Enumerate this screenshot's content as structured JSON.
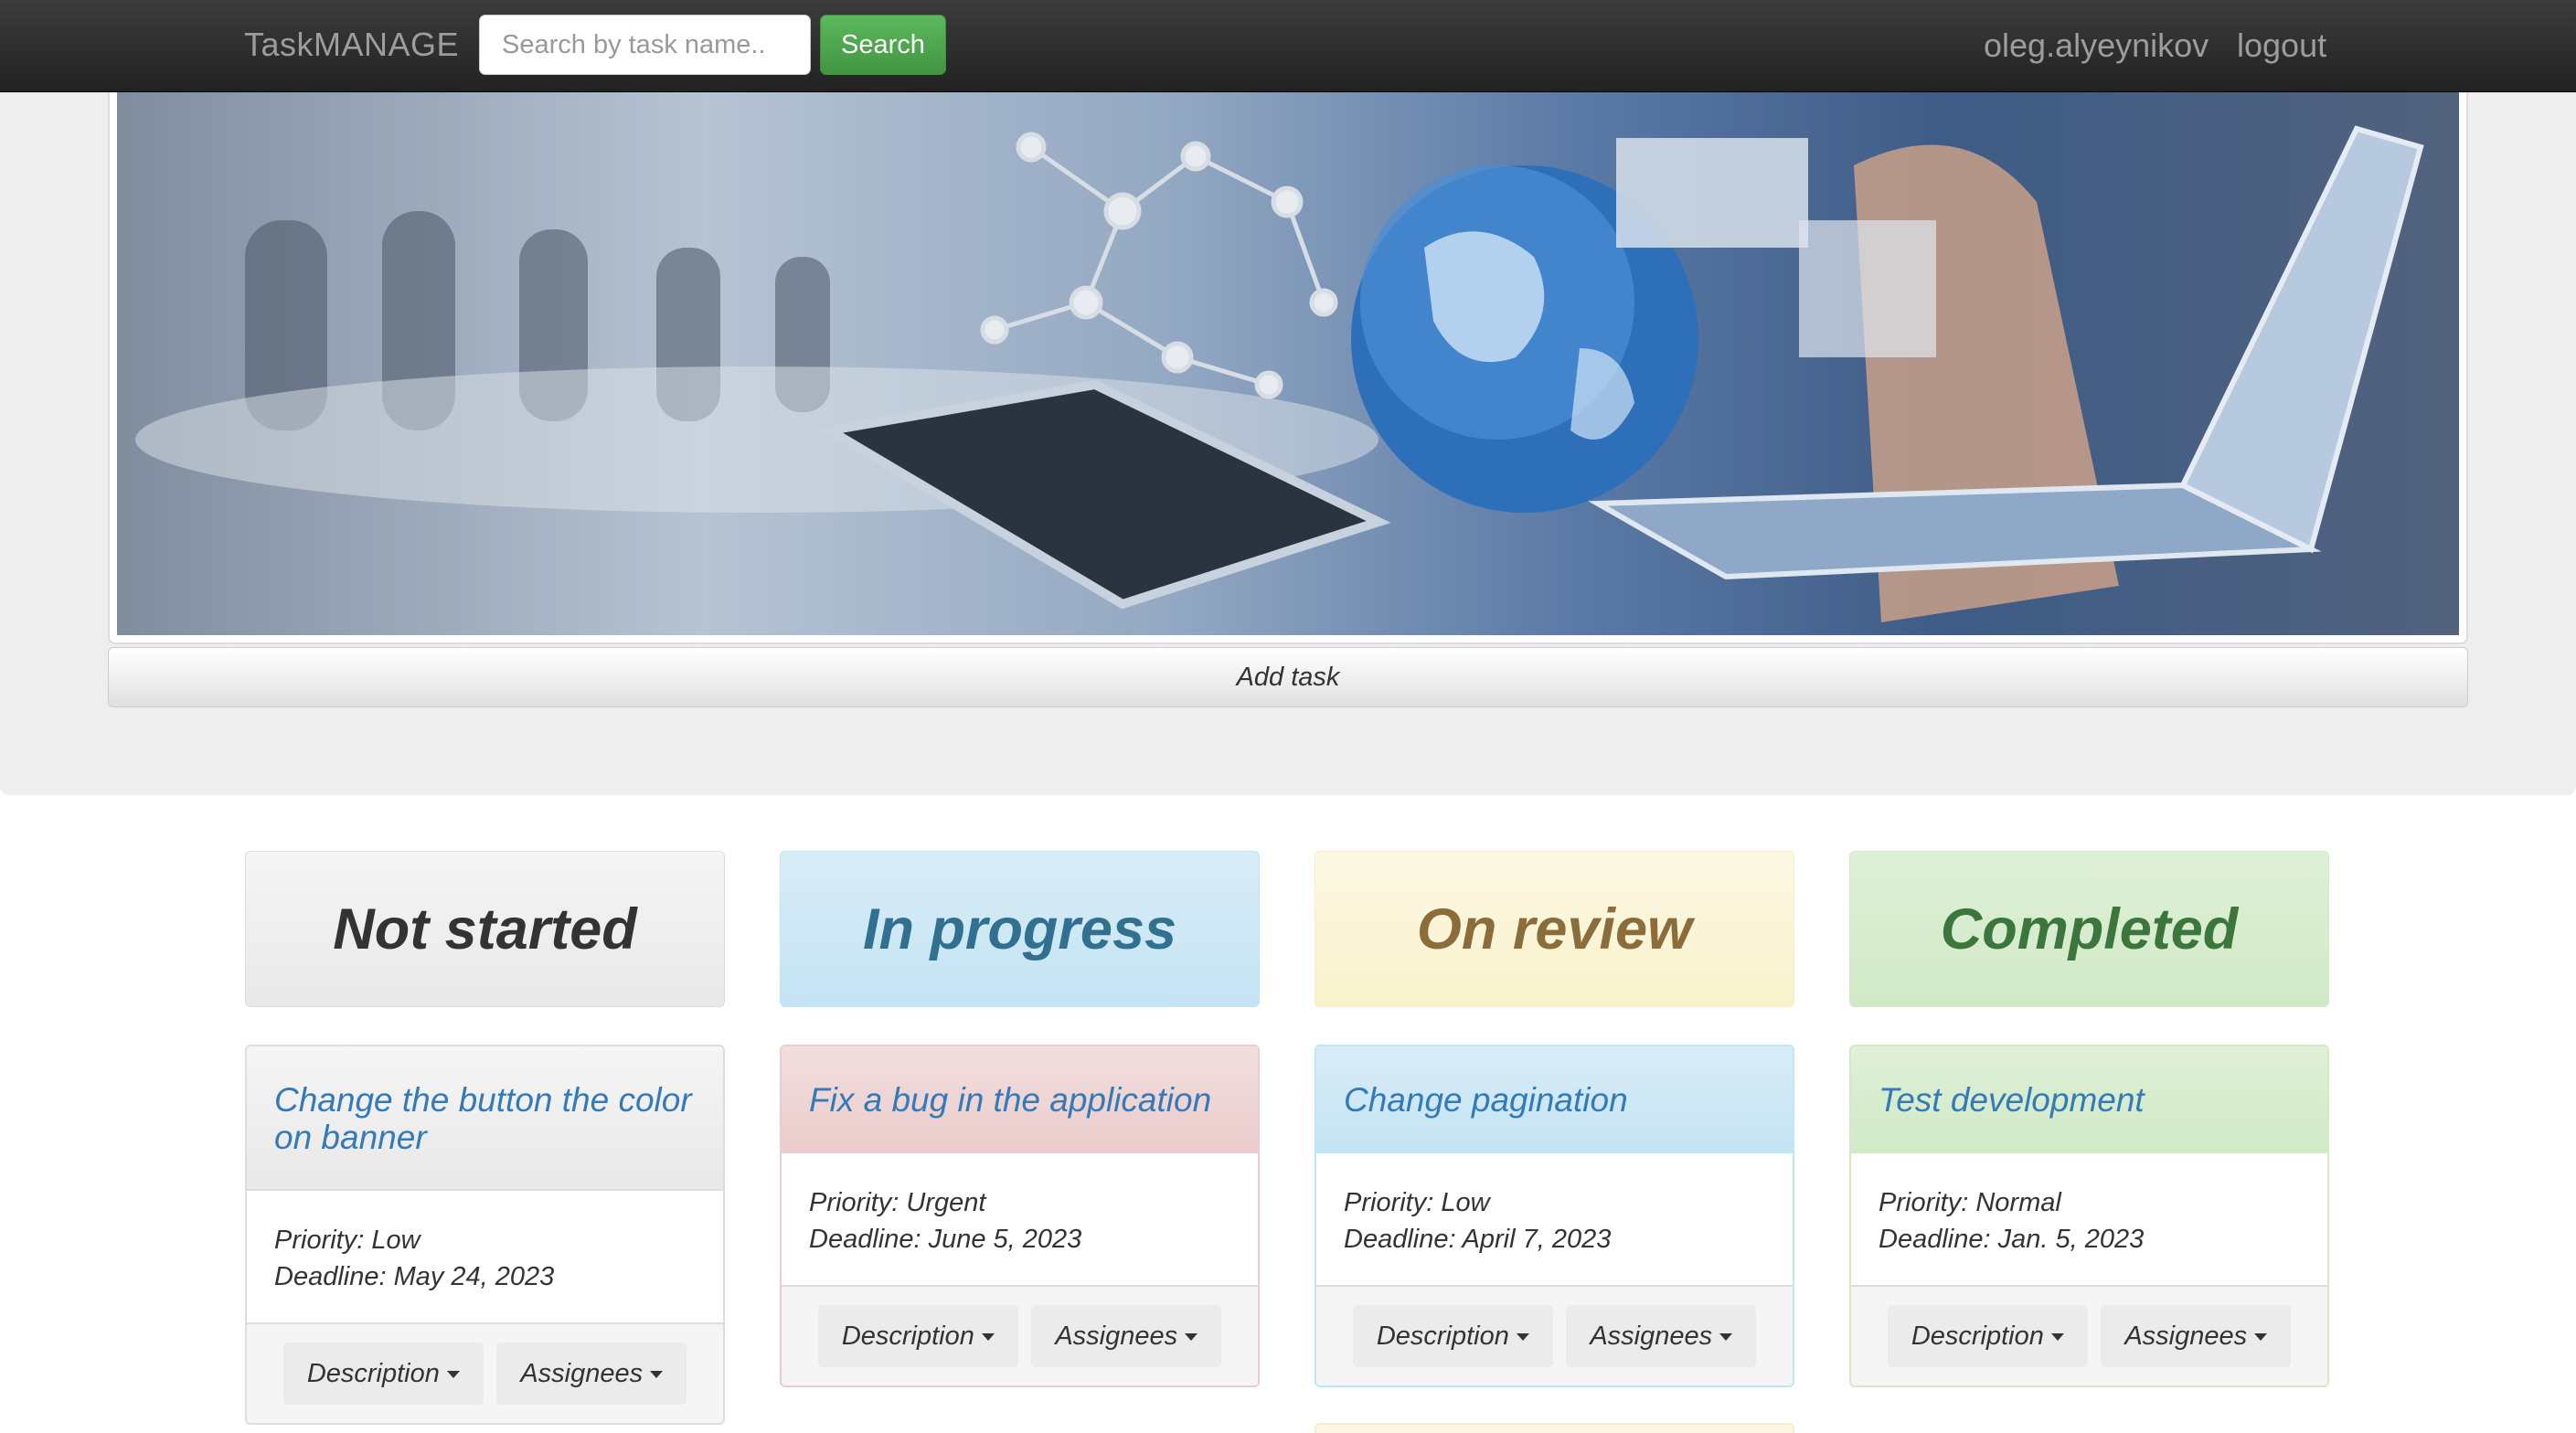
{
  "navbar": {
    "brand": "TaskMANAGE",
    "search_placeholder": "Search by task name..",
    "search_button": "Search",
    "username": "oleg.alyeynikov",
    "logout": "logout"
  },
  "add_task_label": "Add task",
  "columns": [
    {
      "title": "Not started",
      "cards": [
        {
          "title": "Change the button the color on banner",
          "priority": "Priority: Low",
          "deadline": "Deadline: May 24, 2023",
          "description_btn": "Description",
          "assignees_btn": "Assignees"
        }
      ]
    },
    {
      "title": "In progress",
      "cards": [
        {
          "title": "Fix a bug in the application",
          "priority": "Priority: Urgent",
          "deadline": "Deadline: June 5, 2023",
          "description_btn": "Description",
          "assignees_btn": "Assignees"
        }
      ]
    },
    {
      "title": "On review",
      "cards": [
        {
          "title": "Change pagination",
          "priority": "Priority: Low",
          "deadline": "Deadline: April 7, 2023",
          "description_btn": "Description",
          "assignees_btn": "Assignees"
        }
      ]
    },
    {
      "title": "Completed",
      "cards": [
        {
          "title": "Test development",
          "priority": "Priority: Normal",
          "deadline": "Deadline: Jan. 5, 2023",
          "description_btn": "Description",
          "assignees_btn": "Assignees"
        }
      ]
    }
  ],
  "colors": {
    "navbar": "#222222",
    "search_button": "#5cb85c",
    "link": "#337ab7",
    "not_started": "#f5f5f5",
    "in_progress": "#d9edf7",
    "on_review": "#fcf8e3",
    "completed": "#dff0d8",
    "urgent_card": "#f2dede"
  },
  "icons": {
    "dropdown": "caret-down-icon"
  }
}
